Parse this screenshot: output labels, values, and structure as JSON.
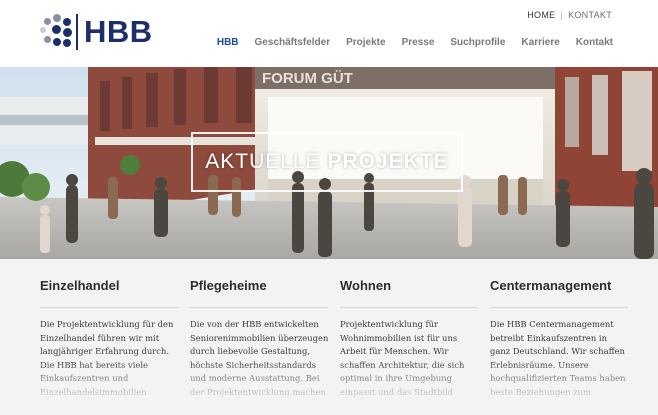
{
  "logo": {
    "text": "HBB"
  },
  "topnav": {
    "home": "HOME",
    "separator": "|",
    "kontakt": "KONTAKT"
  },
  "mainnav": [
    {
      "label": "HBB",
      "current": true
    },
    {
      "label": "Geschäftsfelder"
    },
    {
      "label": "Projekte"
    },
    {
      "label": "Presse"
    },
    {
      "label": "Suchprofile"
    },
    {
      "label": "Karriere"
    },
    {
      "label": "Kontakt"
    }
  ],
  "hero": {
    "title_light": "AKTUELLE ",
    "title_bold": "PROJEKTE",
    "sign": "FORUM GÜT"
  },
  "columns": [
    {
      "title": "Einzelhandel",
      "lines": [
        "Die Projektentwicklung für den",
        "Einzelhandel führen wir mit",
        "langjähriger Erfahrung durch.",
        "Die HBB hat bereits viele",
        "Einkaufszentren und",
        "Einzelhandelsimmobilien"
      ]
    },
    {
      "title": "Pflegeheime",
      "lines": [
        "Die von der HBB entwickelten",
        "Seniorenimmobilien überzeugen",
        "durch liebevolle Gestaltung,",
        "höchste Sicherheitsstandards",
        "und moderne Ausstattung. Bei",
        "der Projektentwicklung machen"
      ]
    },
    {
      "title": "Wohnen",
      "lines": [
        "Projektentwicklung für",
        "Wohnimmobilien ist für uns",
        "Arbeit für Menschen. Wir",
        "schaffen Architektur, die sich",
        "optimal in ihre Umgebung",
        "einpasst und das Stadtbild"
      ]
    },
    {
      "title": "Centermanagement",
      "lines": [
        "Die HBB Centermanagement",
        "betreibt Einkaufszentren in",
        "ganz Deutschland. Wir schaffen",
        "Erlebnisräume. Unsere",
        "hochqualifizierten Teams haben",
        "beste Beziehungen zum"
      ]
    }
  ],
  "colors": {
    "brand": "#1c2f6b",
    "nav_current": "#1c4e94",
    "dots": [
      "#1c2f6b",
      "#8a8fa8",
      "#c9cbd6"
    ]
  }
}
